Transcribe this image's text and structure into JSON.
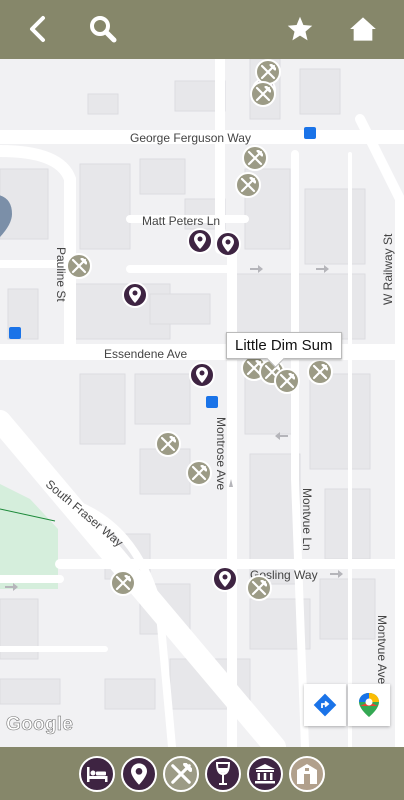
{
  "header": {
    "back_icon": "chevron-left-icon",
    "search_icon": "search-icon",
    "favorite_icon": "star-icon",
    "home_icon": "home-icon"
  },
  "map": {
    "streets": {
      "george_ferguson": "George Ferguson Way",
      "matt_peters": "Matt Peters Ln",
      "pauline": "Pauline St",
      "w_railway": "W Railway St",
      "essendene": "Essendene Ave",
      "montrose": "Montrose Ave",
      "south_fraser": "South Fraser Way",
      "montvue_ln": "Montvue Ln",
      "gosling": "Gosling Way",
      "montvue_ave": "Montvue Ave"
    },
    "selected_place": "Little Dim Sum",
    "attribution": "Google",
    "directions_icon": "directions-icon",
    "google_maps_icon": "google-maps-icon"
  },
  "categories": [
    {
      "icon": "bed-icon",
      "bg": "#3e2442"
    },
    {
      "icon": "location-pin-icon",
      "bg": "#3e2442"
    },
    {
      "icon": "fork-knife-icon",
      "bg": "#9c9b86"
    },
    {
      "icon": "wine-glass-icon",
      "bg": "#3e2442"
    },
    {
      "icon": "museum-icon",
      "bg": "#3e2442"
    },
    {
      "icon": "barn-icon",
      "bg": "#b1a08c"
    }
  ],
  "colors": {
    "bar": "#86876a",
    "pin": "#3e2442",
    "food": "#9c9b86"
  }
}
